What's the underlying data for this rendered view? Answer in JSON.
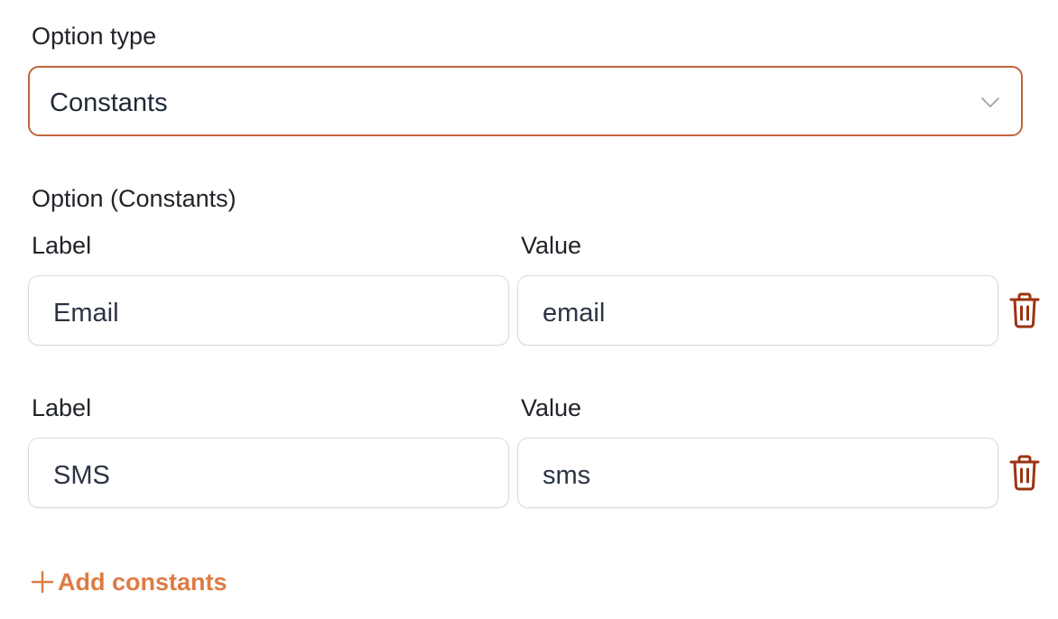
{
  "option_type": {
    "label": "Option type",
    "selected": "Constants"
  },
  "options_section": {
    "title": "Option (Constants)",
    "rows": [
      {
        "label_caption": "Label",
        "value_caption": "Value",
        "label": "Email",
        "value": "email"
      },
      {
        "label_caption": "Label",
        "value_caption": "Value",
        "label": "SMS",
        "value": "sms"
      }
    ]
  },
  "add_button": {
    "label": "Add constants"
  },
  "colors": {
    "accent": "#c2643c",
    "danger": "#9a3412",
    "link": "#db7c43",
    "field_border": "#d7dbe0"
  },
  "icons": {
    "select": "chevron-down-icon",
    "delete": "trash-icon",
    "add": "plus-icon"
  }
}
